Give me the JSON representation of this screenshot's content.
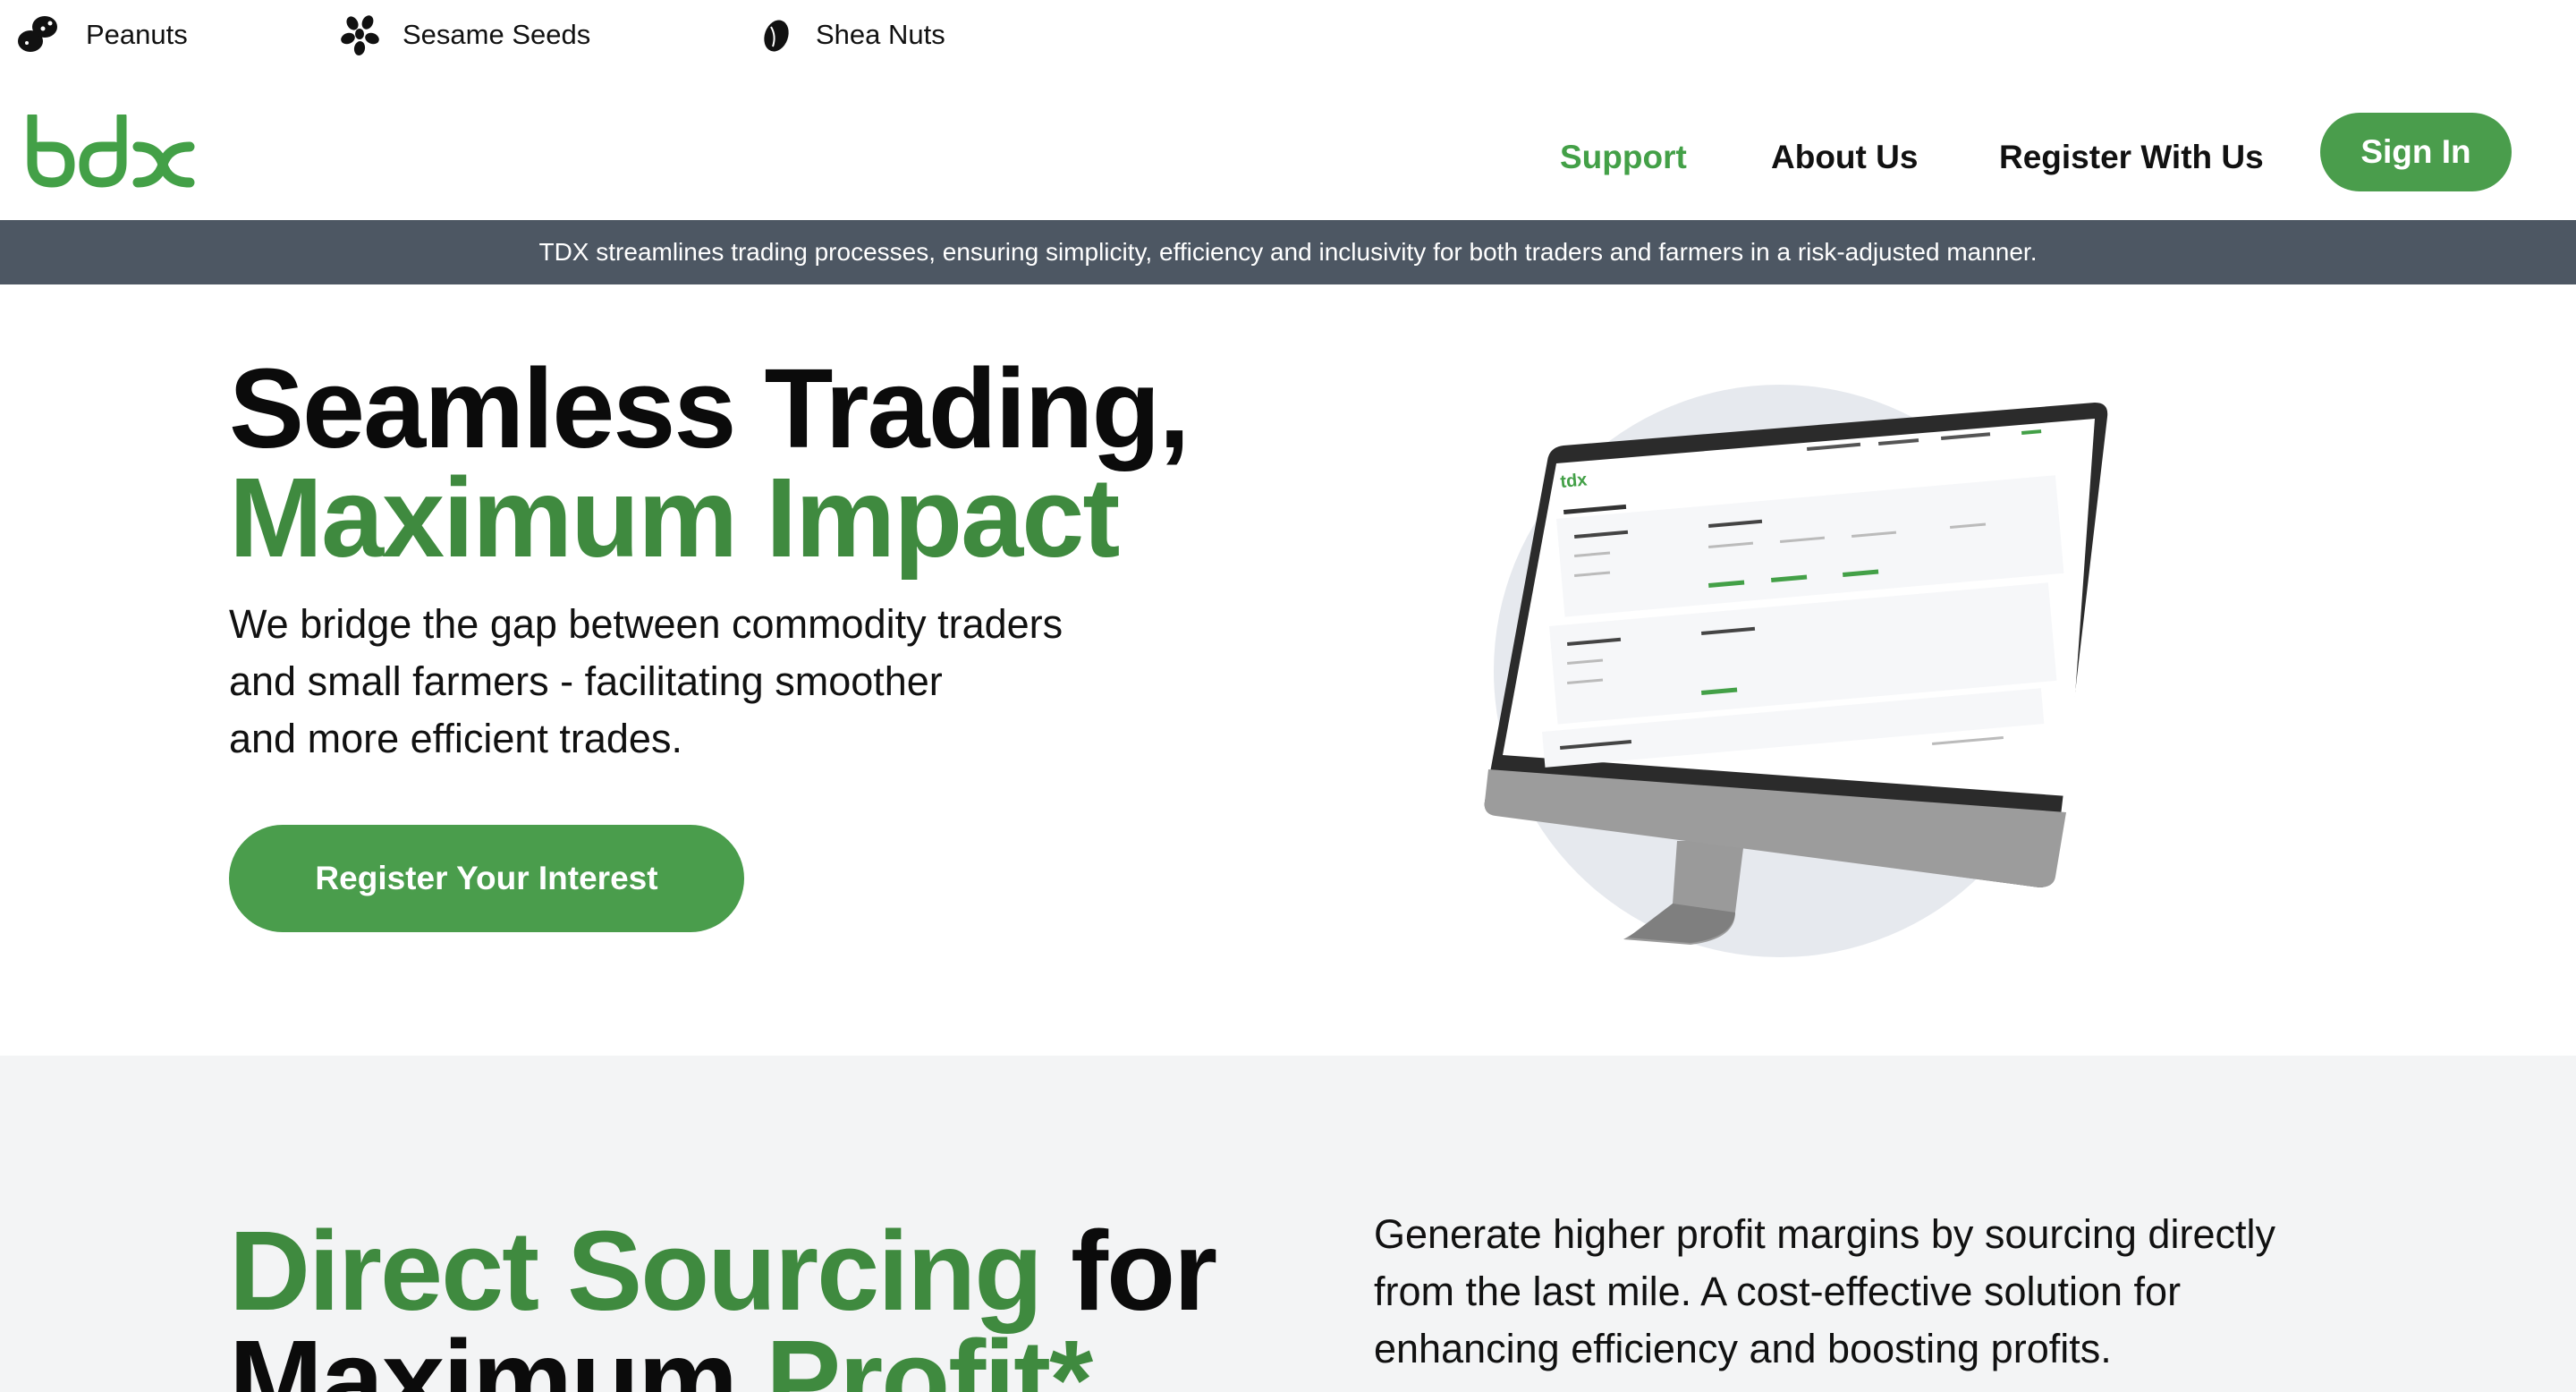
{
  "ticker": [
    {
      "label": "Peanuts",
      "icon": "peanut-icon"
    },
    {
      "label": "Sesame Seeds",
      "icon": "sesame-icon"
    },
    {
      "label": "Shea Nuts",
      "icon": "shea-nut-icon"
    }
  ],
  "header": {
    "logo": "tdx",
    "nav": {
      "support": "Support",
      "about": "About Us",
      "register": "Register With Us"
    },
    "signin": "Sign In"
  },
  "banner": {
    "text": "TDX streamlines trading processes, ensuring simplicity, efficiency and inclusivity for both traders and farmers in a risk-adjusted manner."
  },
  "hero": {
    "title_line1": "Seamless Trading,",
    "title_line2": "Maximum Impact",
    "subtitle": [
      "We bridge the gap between commodity traders",
      "and small farmers - facilitating smoother",
      "and more efficient trades."
    ],
    "cta": "Register Your Interest"
  },
  "section2": {
    "title_part1": "Direct Sourcing",
    "title_part2": " for",
    "title_part3": "Maximum ",
    "title_part4": "Profit*",
    "text": [
      "Generate higher profit margins by sourcing directly",
      "from the last mile. A cost-effective solution for",
      "enhancing efficiency and boosting profits."
    ]
  },
  "colors": {
    "brand_green": "#4a9d4c",
    "title_green": "#3f8a3f",
    "banner_bg": "#4d5763",
    "section_bg": "#f3f4f5"
  }
}
